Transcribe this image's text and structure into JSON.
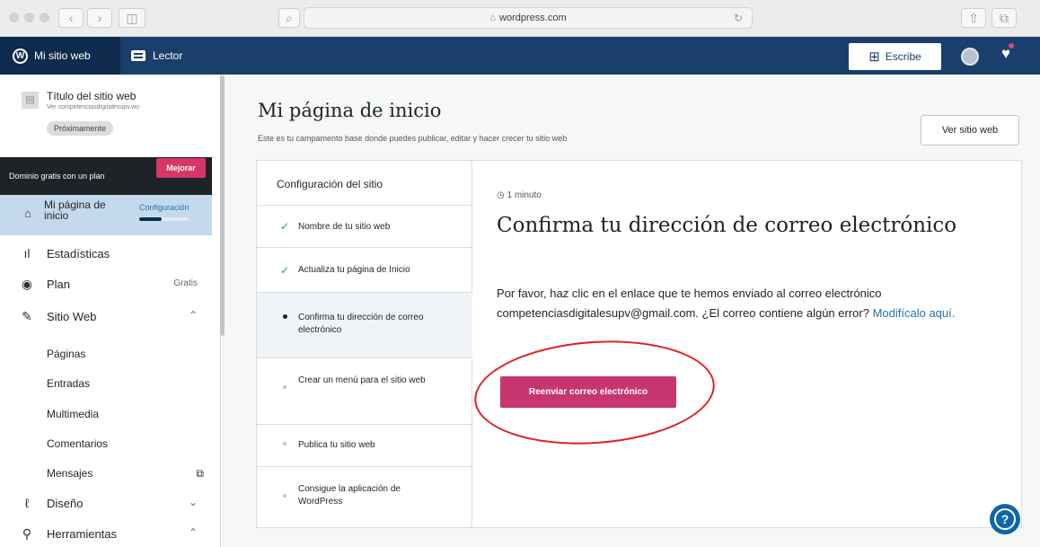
{
  "browser": {
    "url": "wordpress.com",
    "back_glyph": "‹",
    "forward_glyph": "›",
    "lock_glyph": "⌂",
    "reload_glyph": "↻",
    "search_glyph": "⌕",
    "share_glyph": "⇧",
    "tabs_glyph": "⧉",
    "sidebar_glyph": "◫"
  },
  "masterbar": {
    "my_site_label": "Mi sitio web",
    "reader_label": "Lector",
    "write_label": "Escribe",
    "wp_logo_glyph": "W",
    "write_glyph": "⊞",
    "notif_glyph": "♥",
    "bg_color": "#1a3f6c"
  },
  "sidebar": {
    "site_title": "Título del sitio web",
    "site_url": "Ver competenciasdigitalesupv.wo",
    "site_badge": "Próximamente",
    "domain_banner": "Dominio gratis con un plan",
    "upgrade_label": "Mejorar",
    "home_label": "Mi página de inicio",
    "home_config": "Configuración",
    "home_progress": 0.45,
    "stats_label": "Estadísticas",
    "plan_label": "Plan",
    "plan_value": "Gratis",
    "site_label": "Sitio Web",
    "sub_items": [
      "Páginas",
      "Entradas",
      "Multimedia",
      "Comentarios",
      "Mensajes"
    ],
    "design_label": "Diseño",
    "tools_label": "Herramientas",
    "icons": {
      "home": "⌂",
      "stats": "ıl",
      "plan": "◉",
      "site": "✎",
      "design": "ℓ",
      "tools": "⚲",
      "chevron_up": "⌃",
      "chevron_down": "⌄",
      "external": "⧉"
    }
  },
  "main": {
    "title": "Mi página de inicio",
    "subtitle": "Este es tu campamento base donde puedes publicar, editar y hacer crecer tu sitio web",
    "view_site": "Ver sitio web",
    "steps_heading": "Configuración del sitio",
    "steps": [
      {
        "label": "Nombre de tu sitio web",
        "state": "done"
      },
      {
        "label": "Actualiza tu página de Inicio",
        "state": "done"
      },
      {
        "label": "Confirma tu dirección de correo electrónico",
        "state": "active"
      },
      {
        "label": "Crear un menú para el sitio web",
        "state": "pending"
      },
      {
        "label": "Publica tu sitio web",
        "state": "pending"
      },
      {
        "label": "Consigue la aplicación de WordPress",
        "state": "pending"
      }
    ],
    "check_glyph": "✓",
    "detail": {
      "time": "1 minuto",
      "clock_glyph": "◷",
      "title": "Confirma tu dirección de correo electrónico",
      "body_prefix": "Por favor, haz clic en el enlace que te hemos enviado al correo electrónico competenciasdigitalesupv@gmail.com. ¿El correo contiene algún error? ",
      "body_link": "Modifícalo aquí.",
      "resend_label": "Reenviar correo electrónico",
      "resend_color": "#c9356e"
    },
    "help_glyph": "?"
  }
}
